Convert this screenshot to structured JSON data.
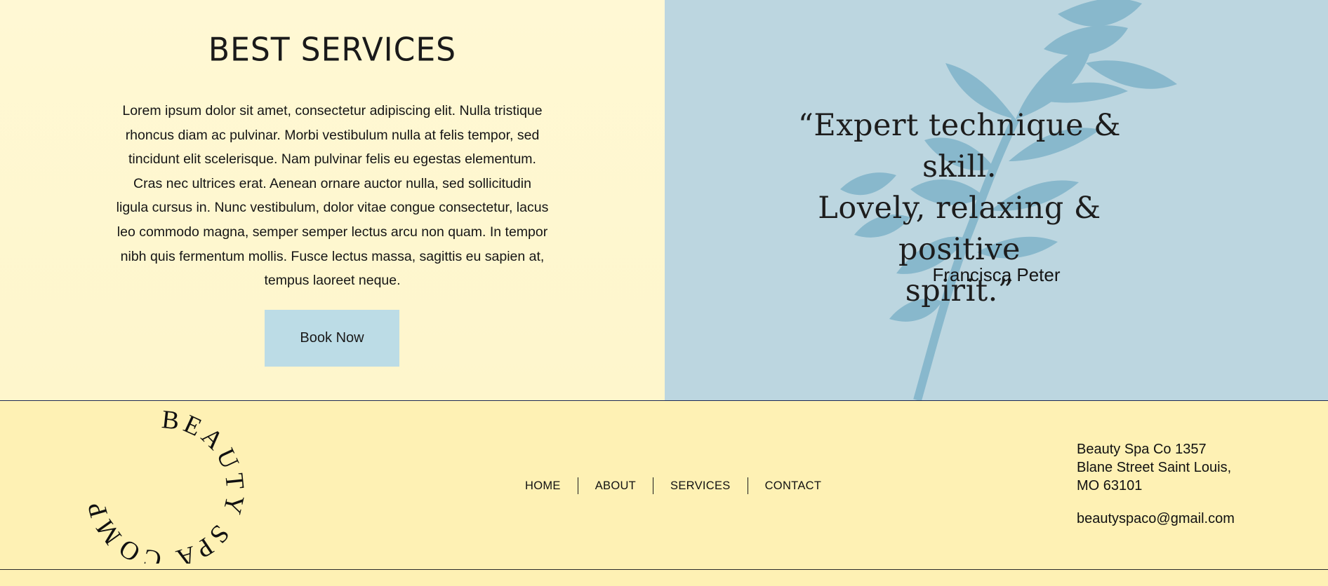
{
  "services": {
    "title": "BEST SERVICES",
    "body": "Lorem ipsum dolor sit amet, consectetur adipiscing elit. Nulla tristique rhoncus diam ac pulvinar. Morbi vestibulum nulla at felis tempor, sed tincidunt elit scelerisque. Nam pulvinar felis eu egestas elementum. Cras nec ultrices erat. Aenean ornare auctor nulla, sed sollicitudin ligula cursus in. Nunc vestibulum, dolor vitae congue consectetur, lacus leo commodo magna, semper semper lectus arcu non quam. In tempor nibh quis fermentum mollis. Fusce lectus massa, sagittis eu sapien at, tempus laoreet neque.",
    "button_label": "Book Now"
  },
  "testimonial": {
    "quote_lines": [
      "“Expert technique & skill.",
      "Lovely, relaxing & positive",
      "spirit.”"
    ],
    "author": "Francisca Peter"
  },
  "footer": {
    "logo_text": "BEAUTY SPA COMPANY",
    "nav": [
      {
        "label": "HOME"
      },
      {
        "label": "ABOUT"
      },
      {
        "label": "SERVICES"
      },
      {
        "label": "CONTACT"
      }
    ],
    "address_lines": [
      "Beauty Spa Co 1357",
      "Blane Street Saint Louis,",
      "MO 63101"
    ],
    "email": "beautyspaco@gmail.com"
  },
  "colors": {
    "services_bg": "#fff8d4",
    "testimonial_bg": "#bcd6e0",
    "leaf": "#7fb6cc",
    "button_bg": "#bcdce6",
    "footer_bg": "#fef1b4"
  }
}
